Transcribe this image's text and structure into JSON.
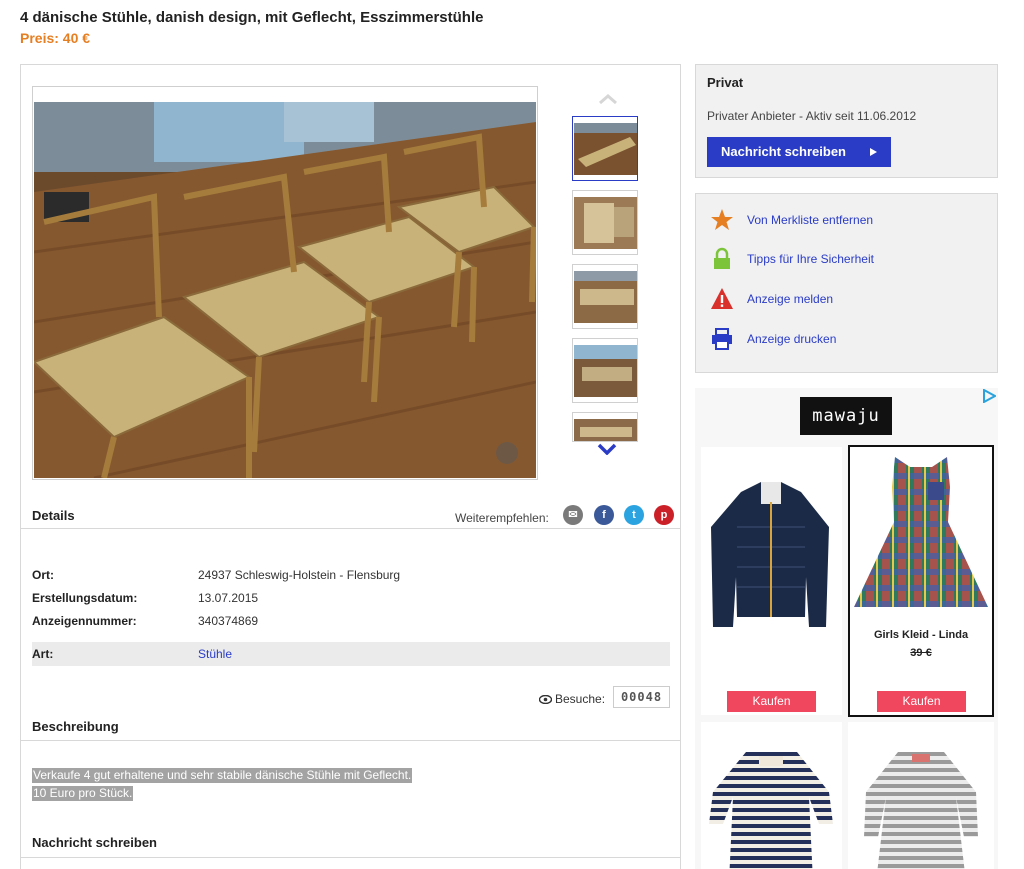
{
  "listing": {
    "title": "4 dänische Stühle, danish design, mit Geflecht, Esszimmerstühle",
    "price": "Preis: 40 €"
  },
  "details": {
    "heading": "Details",
    "share_label": "Weiterempfehlen:",
    "share_icons": [
      "email-icon",
      "facebook-icon",
      "twitter-icon",
      "pinterest-icon"
    ],
    "rows": [
      {
        "label": "Ort:",
        "value": "24937 Schleswig-Holstein - Flensburg"
      },
      {
        "label": "Erstellungsdatum:",
        "value": "13.07.2015"
      },
      {
        "label": "Anzeigennummer:",
        "value": "340374869"
      }
    ],
    "art": {
      "label": "Art:",
      "value": "Stühle"
    },
    "visits_label": "Besuche:",
    "visits_count": "00048"
  },
  "description": {
    "heading": "Beschreibung",
    "lines": [
      "Verkaufe 4 gut erhaltene und sehr stabile dänische Stühle mit Geflecht.",
      "10 Euro pro Stück."
    ]
  },
  "message_section": {
    "heading": "Nachricht schreiben"
  },
  "seller": {
    "title": "Privat",
    "subtitle": "Privater Anbieter - Aktiv seit 11.06.2012",
    "button": "Nachricht schreiben"
  },
  "actions": [
    {
      "label": "Von Merkliste entfernen",
      "icon": "star-icon",
      "color": "#e67e22"
    },
    {
      "label": "Tipps für Ihre Sicherheit",
      "icon": "lock-icon",
      "color": "#7cc43a"
    },
    {
      "label": "Anzeige melden",
      "icon": "warning-icon",
      "color": "#d9302c"
    },
    {
      "label": "Anzeige drucken",
      "icon": "printer-icon",
      "color": "#2a3cc6"
    }
  ],
  "ad": {
    "brand": "mawaju",
    "products": [
      {
        "name": "",
        "price": "",
        "button": "Kaufen"
      },
      {
        "name": "Girls Kleid - Linda",
        "price": "39 €",
        "button": "Kaufen"
      }
    ]
  },
  "colors": {
    "accent_blue": "#2a3cc6",
    "price_orange": "#e67e22",
    "buy_button": "#f0475e"
  }
}
